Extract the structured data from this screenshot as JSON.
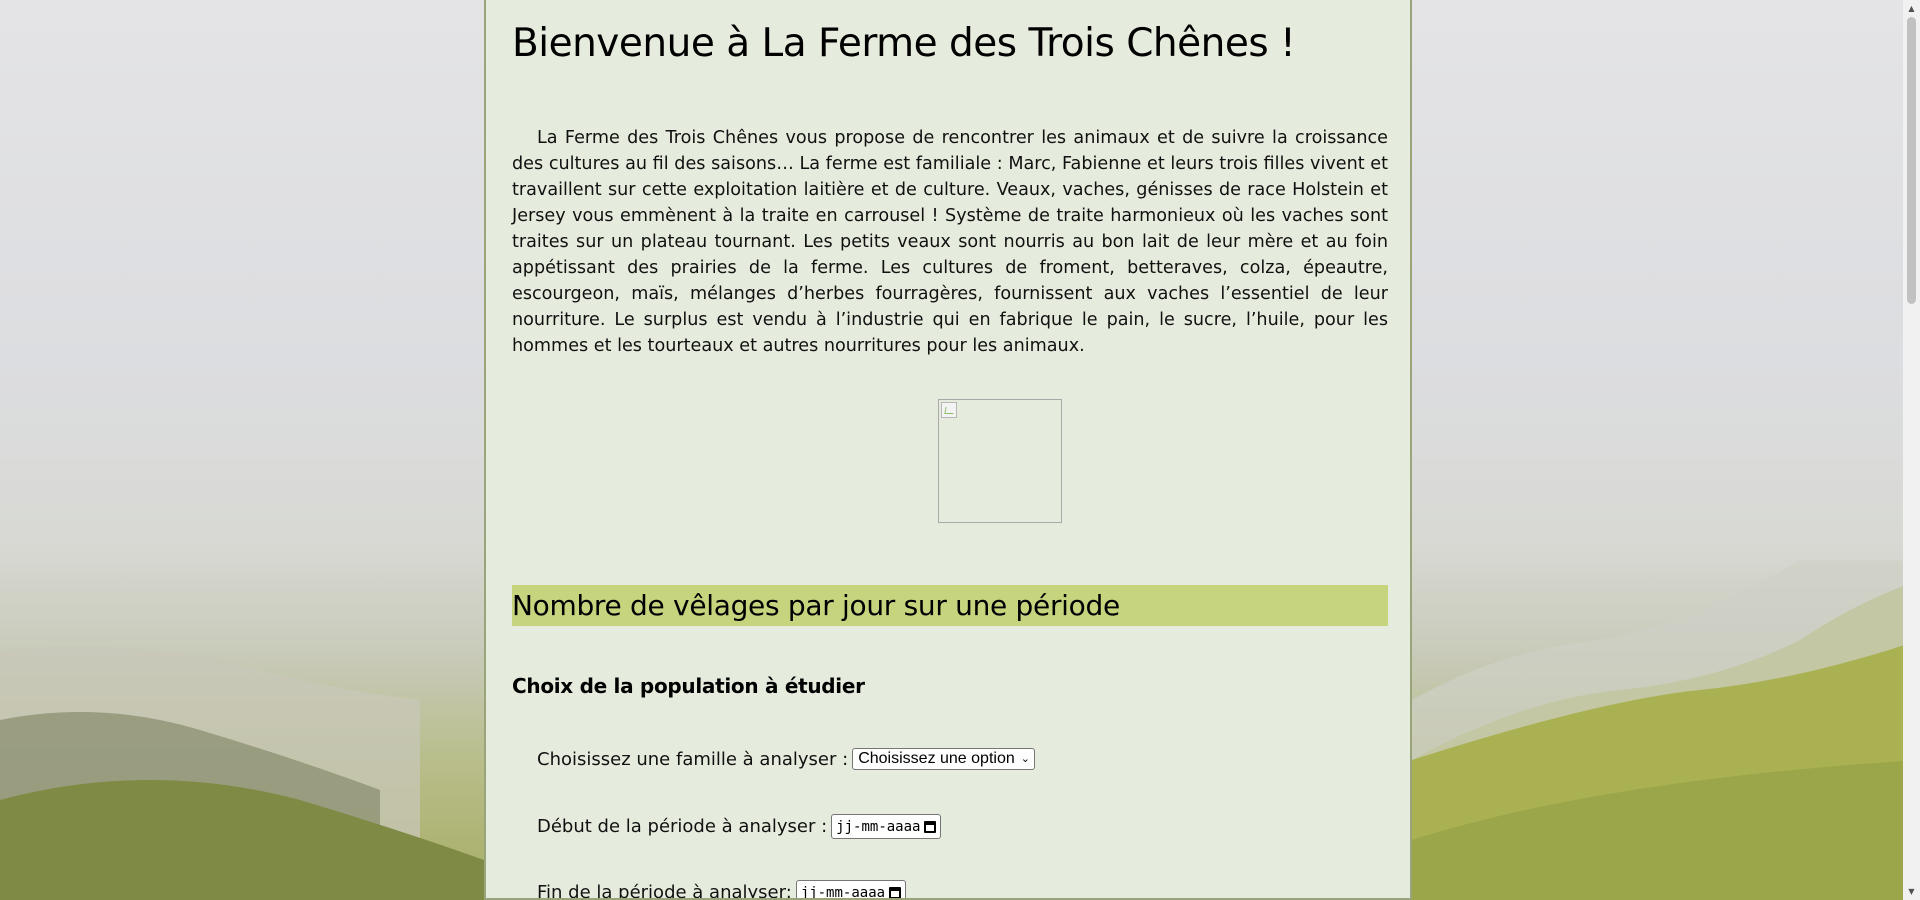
{
  "page": {
    "title": "Bienvenue à La Ferme des Trois Chênes !",
    "intro": "La Ferme des Trois Chênes vous propose de rencontrer les animaux et de suivre la croissance des cultures au fil des saisons… La ferme est familiale : Marc, Fabienne et leurs trois filles vivent et travaillent sur cette exploitation laitière et de culture. Veaux, vaches, génisses de race Holstein et Jersey vous emmènent à la traite en carrousel ! Système de traite harmonieux où les vaches sont traites sur un plateau tournant. Les petits veaux sont nourris au bon lait de leur mère et au foin appétissant des prairies de la ferme. Les cultures de froment, betteraves, colza, épeautre, escourgeon, maïs, mélanges d’herbes fourragères, fournissent aux vaches l’essentiel de leur nourriture. Le surplus est vendu à l’industrie qui en fabrique le pain, le sucre, l’huile, pour les hommes et les tourteaux et autres nourritures pour les animaux.",
    "section_title": "Nombre de vêlages par jour sur une période",
    "subsection_title": "Choix de la population à étudier"
  },
  "form": {
    "family_label": "Choisissez une famille à analyser :",
    "family_value": "Choisissez une option",
    "start_label": "Début de la période à analyser :",
    "start_value": "jj-mm-aaaa",
    "end_label": "Fin de la période à analyser:",
    "end_value": "jj-mm-aaaa"
  },
  "colors": {
    "panel_bg": "#e6ecdd",
    "section_highlight": "#c6d47e",
    "panel_border": "#9aa47a"
  }
}
